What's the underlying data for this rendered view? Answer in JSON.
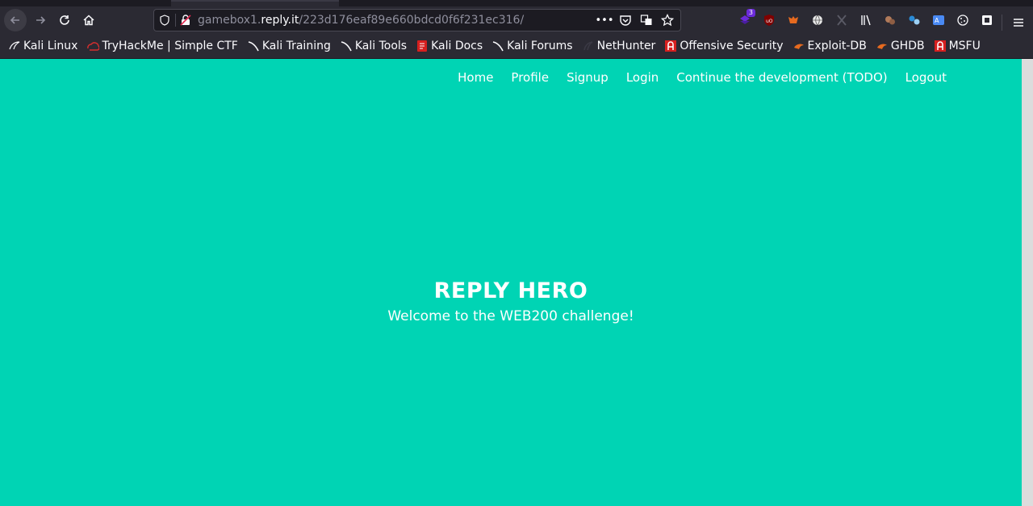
{
  "browser": {
    "url_path": "gamebox1.",
    "url_host": "reply.it",
    "url_rest": "/223d176eaf89e660bdcd0f6f231ec316/",
    "extension_badge": "3",
    "bookmarks": [
      {
        "label": "Kali Linux",
        "icon": "kali-dragon-icon"
      },
      {
        "label": "TryHackMe | Simple CTF",
        "icon": "tryhackme-icon"
      },
      {
        "label": "Kali Training",
        "icon": "kali-dragon-icon"
      },
      {
        "label": "Kali Tools",
        "icon": "kali-dragon-icon"
      },
      {
        "label": "Kali Docs",
        "icon": "kali-docs-icon"
      },
      {
        "label": "Kali Forums",
        "icon": "kali-dragon-icon"
      },
      {
        "label": "NetHunter",
        "icon": "nethunter-icon"
      },
      {
        "label": "Offensive Security",
        "icon": "offsec-icon"
      },
      {
        "label": "Exploit-DB",
        "icon": "exploitdb-icon"
      },
      {
        "label": "GHDB",
        "icon": "exploitdb-icon"
      },
      {
        "label": "MSFU",
        "icon": "offsec-icon"
      }
    ]
  },
  "site": {
    "nav": [
      "Home",
      "Profile",
      "Signup",
      "Login",
      "Continue the development (TODO)",
      "Logout"
    ],
    "hero_title": "REPLY HERO",
    "hero_subtitle": "Welcome to the WEB200 challenge!",
    "background_color": "#00d4b4"
  }
}
